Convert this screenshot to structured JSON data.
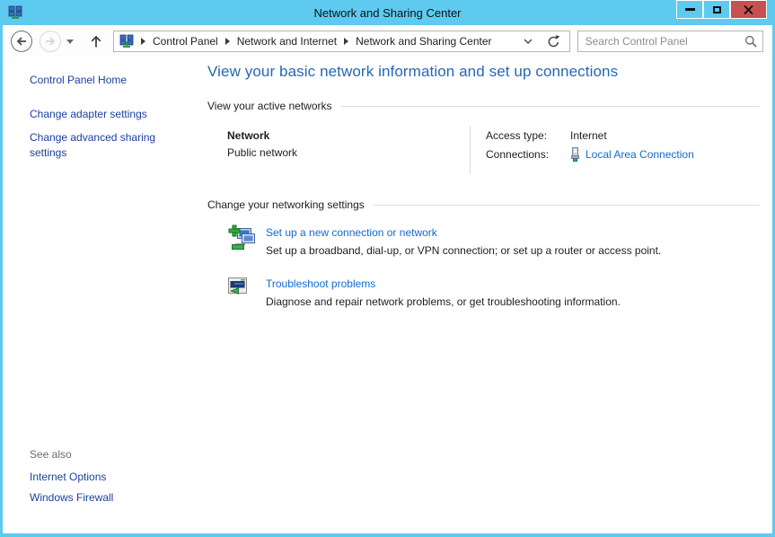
{
  "window": {
    "title": "Network and Sharing Center"
  },
  "colors": {
    "titlebar": "#5ecaf0",
    "close_button": "#c75050",
    "heading": "#2767b3",
    "hyperlink": "#0f6bd2",
    "sidebar_link": "#1c3f9e",
    "muted_text": "#6d6d6d",
    "rule": "#dcdcdc"
  },
  "icons": {
    "network-icon": "two blue monitors with green base",
    "back-icon": "←",
    "forward-icon": "→",
    "history-dropdown-icon": "▾",
    "up-icon": "↑",
    "breadcrumb-separator-icon": "▶",
    "address-dropdown-icon": "⌄",
    "refresh-icon": "⟳",
    "search-icon": "⌕",
    "ethernet-icon": "gray plug with blue cable",
    "new-connection-icon": "monitors with green plus",
    "troubleshoot-icon": "monitor with green arrow",
    "minimize-icon": "–",
    "maximize-icon": "□",
    "close-icon": "✕"
  },
  "nav": {
    "breadcrumb": {
      "items": [
        "Control Panel",
        "Network and Internet",
        "Network and Sharing Center"
      ]
    },
    "search": {
      "placeholder": "Search Control Panel"
    }
  },
  "sidebar": {
    "home": "Control Panel Home",
    "tasks": [
      "Change adapter settings",
      "Change advanced sharing settings"
    ],
    "see_also": {
      "heading": "See also",
      "links": [
        "Internet Options",
        "Windows Firewall"
      ]
    }
  },
  "main": {
    "heading": "View your basic network information and set up connections",
    "active_label": "View your active networks",
    "network": {
      "name": "Network",
      "type": "Public network",
      "access_label": "Access type:",
      "access_value": "Internet",
      "connections_label": "Connections:",
      "connections_value": "Local Area Connection"
    },
    "settings_label": "Change your networking settings",
    "items": [
      {
        "title": "Set up a new connection or network",
        "desc": "Set up a broadband, dial-up, or VPN connection; or set up a router or access point."
      },
      {
        "title": "Troubleshoot problems",
        "desc": "Diagnose and repair network problems, or get troubleshooting information."
      }
    ]
  }
}
